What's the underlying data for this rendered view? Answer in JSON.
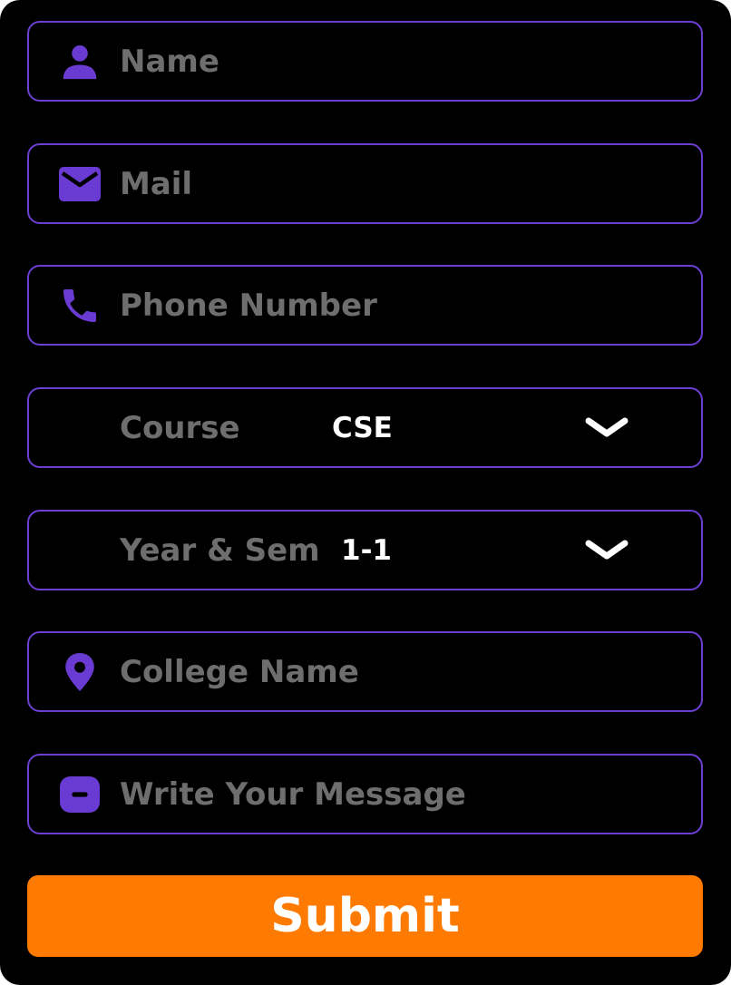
{
  "form": {
    "name_placeholder": "Name",
    "mail_placeholder": "Mail",
    "phone_placeholder": "Phone Number",
    "course_label": "Course",
    "course_value": "CSE",
    "year_sem_label": "Year & Sem",
    "year_sem_value": "1-1",
    "college_placeholder": "College Name",
    "message_placeholder": "Write Your Message",
    "submit_label": "Submit"
  },
  "icons": {
    "name": "person-icon",
    "mail": "mail-icon",
    "phone": "phone-icon",
    "course": "chevron-down-icon",
    "year_sem": "chevron-down-icon",
    "college": "location-pin-icon",
    "message": "message-icon"
  },
  "colors": {
    "background": "#000000",
    "field_border": "#6b3fd0",
    "icon": "#6a3bd2",
    "placeholder_text": "#6e6e6e",
    "value_text": "#ffffff",
    "submit_background": "#ff7a00",
    "submit_text": "#ffffff"
  }
}
